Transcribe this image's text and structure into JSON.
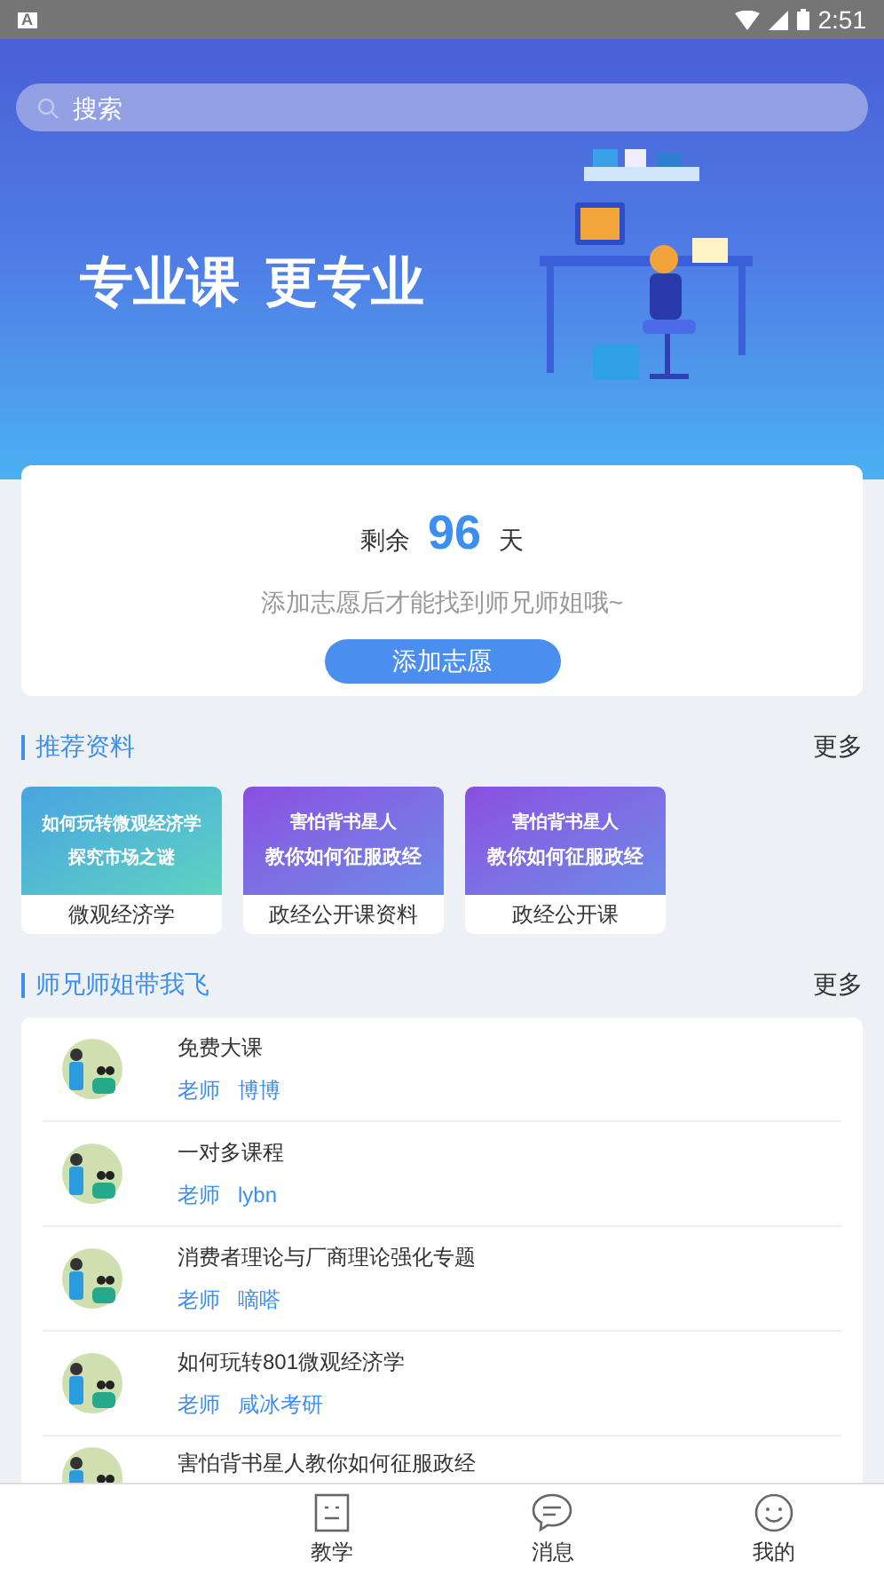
{
  "status_bar": {
    "time": "2:51",
    "notification": "A"
  },
  "search": {
    "placeholder": "搜索"
  },
  "banner": {
    "slogan_1": "专业课",
    "slogan_2": "更专业"
  },
  "countdown": {
    "prefix": "剩余",
    "days": "96",
    "suffix": "天",
    "hint": "添加志愿后才能找到师兄师姐哦~",
    "button": "添加志愿"
  },
  "resources": {
    "title": "推荐资料",
    "more": "更多",
    "items": [
      {
        "kind": "teal",
        "cover_1": "如何玩转微观经济学",
        "cover_2": "探究市场之谜",
        "label": "微观经济学"
      },
      {
        "kind": "violet",
        "cover_1": "害怕背书星人",
        "cover_2": "教你如何征服政经",
        "label": "政经公开课资料"
      },
      {
        "kind": "violet",
        "cover_1": "害怕背书星人",
        "cover_2": "教你如何征服政经",
        "label": "政经公开课"
      }
    ]
  },
  "mentors": {
    "title": "师兄师姐带我飞",
    "more": "更多",
    "items": [
      {
        "course": "免费大课",
        "role": "老师",
        "teacher": "博博"
      },
      {
        "course": "一对多课程",
        "role": "老师",
        "teacher": "lybn"
      },
      {
        "course": "消费者理论与厂商理论强化专题",
        "role": "老师",
        "teacher": "嘀嗒"
      },
      {
        "course": "如何玩转801微观经济学",
        "role": "老师",
        "teacher": "咸冰考研"
      },
      {
        "course": "害怕背书星人教你如何征服政经"
      }
    ]
  },
  "tab_bar": [
    {
      "kind": "hidden"
    },
    {
      "kind": "book",
      "label": "教学",
      "selected": false
    },
    {
      "kind": "chat",
      "label": "消息",
      "selected": false
    },
    {
      "kind": "smile",
      "label": "我的",
      "selected": false
    }
  ]
}
